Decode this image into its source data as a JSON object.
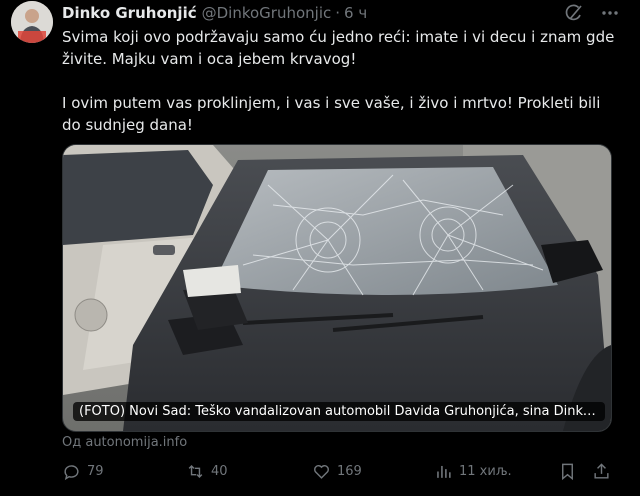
{
  "tweet": {
    "author_name": "Dinko Gruhonjić",
    "handle": "@DinkoGruhonjic",
    "separator": "·",
    "time": "6 ч",
    "paragraphs": [
      "Svima koji ovo podržavaju samo ću jedno reći: imate i vi decu i znam gde živite. Majku vam i oca jebem krvavog!",
      "I ovim putem vas proklinjem, i vas i sve vaše, i živo i mrtvo! Prokleti bili do sudnjeg dana!"
    ]
  },
  "card": {
    "caption": "(FOTO) Novi Sad: Teško vandalizovan automobil Davida Gruhonjića, sina Dinka...",
    "source": "Од autonomija.info"
  },
  "actions": {
    "replies": "79",
    "reposts": "40",
    "likes": "169",
    "views": "11 хиљ."
  },
  "icons": {
    "header": [
      "grok-icon",
      "more-icon"
    ],
    "actions": [
      "reply-icon",
      "repost-icon",
      "like-icon",
      "views-icon",
      "bookmark-icon",
      "share-icon"
    ]
  },
  "colors": {
    "background": "#000000",
    "text": "#e7e9ea",
    "secondary": "#71767b",
    "border": "#2f3336"
  }
}
